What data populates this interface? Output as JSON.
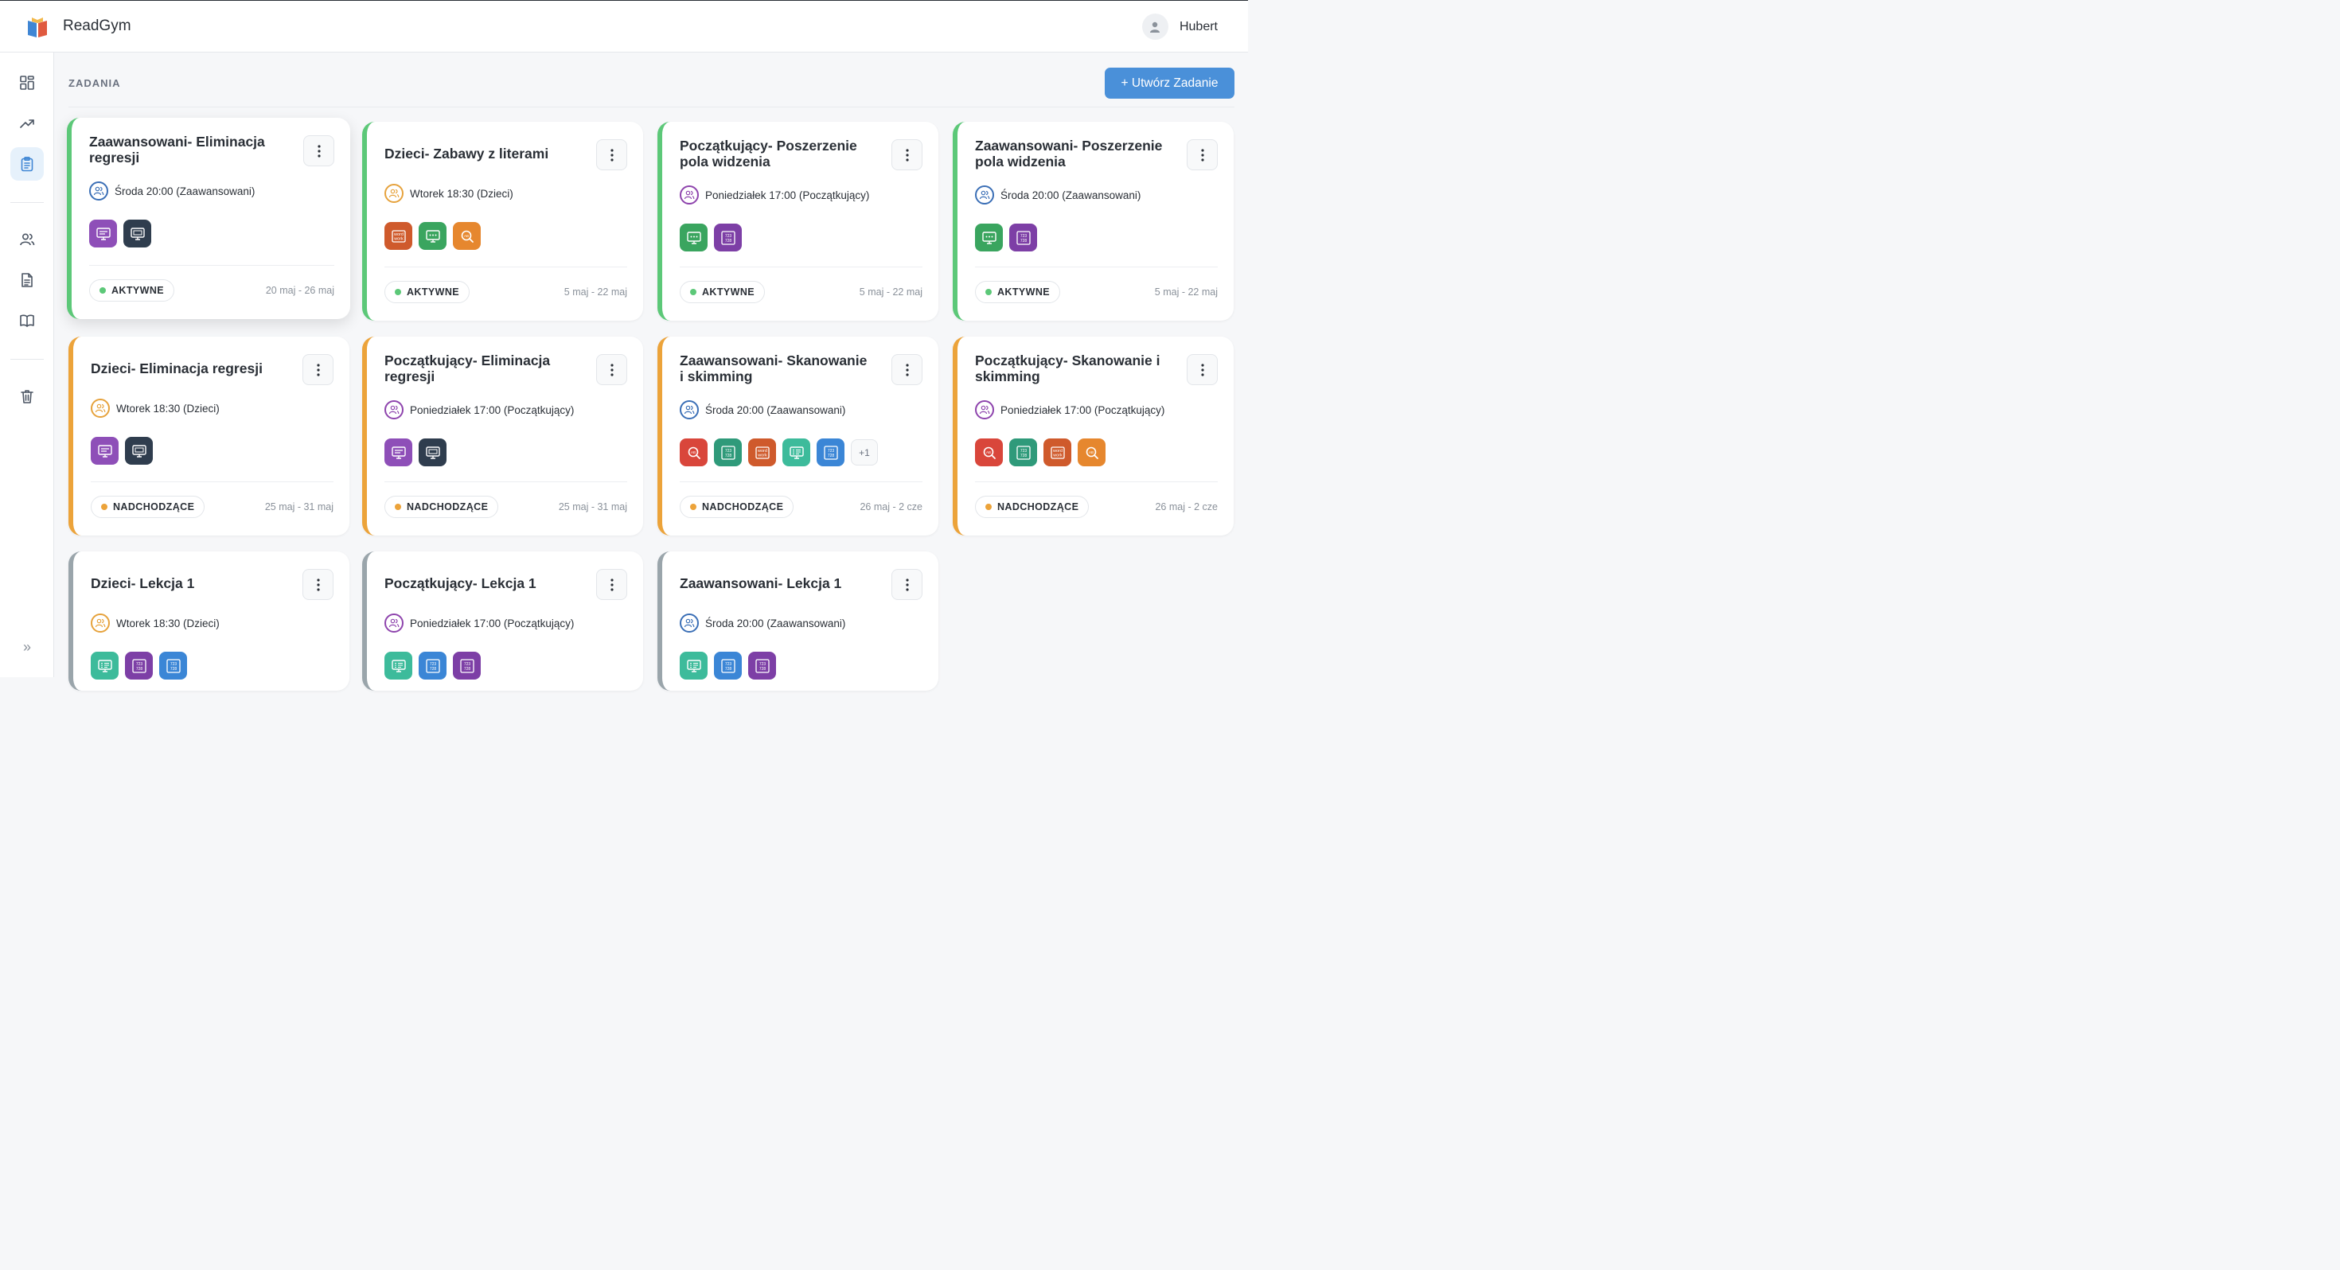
{
  "app": {
    "title": "ReadGym"
  },
  "user": {
    "name": "Hubert"
  },
  "page": {
    "section_title": "ZADANIA",
    "create_button": "+ Utwórz Zadanie"
  },
  "colors": {
    "accent": "#4a90d9",
    "active": "#5cc878",
    "upcoming": "#eca33a",
    "draft": "#9aa5ab"
  },
  "sidebar": {
    "items": [
      {
        "icon": "dashboard-icon"
      },
      {
        "icon": "trend-icon"
      },
      {
        "icon": "clipboard-icon",
        "active": true
      },
      {
        "icon": "users-icon"
      },
      {
        "icon": "document-icon"
      },
      {
        "icon": "book-icon"
      },
      {
        "icon": "trash-icon"
      },
      {
        "icon": "expand-icon",
        "label": "»"
      }
    ]
  },
  "cards": [
    {
      "title": "Zaawansowani- Eliminacja regresji",
      "group": "Środa 20:00 (Zaawansowani)",
      "group_color": "#3b6fb6",
      "exercises": [
        "monitor-purple",
        "monitor-dark"
      ],
      "more": "",
      "status": "AKTYWNE",
      "status_type": "active",
      "dates": "20 maj - 26 maj"
    },
    {
      "title": "Dzieci- Zabawy z literami",
      "group": "Wtorek 18:30 (Dzieci)",
      "group_color": "#e6a23c",
      "exercises": [
        "word-work",
        "dots-green",
        "search-orange"
      ],
      "more": "",
      "status": "AKTYWNE",
      "status_type": "active",
      "dates": "5 maj - 22 maj"
    },
    {
      "title": "Początkujący- Poszerzenie pola widzenia",
      "group": "Poniedziałek 17:00 (Początkujący)",
      "group_color": "#8e44ad",
      "exercises": [
        "dots-green",
        "numbers-purple"
      ],
      "more": "",
      "status": "AKTYWNE",
      "status_type": "active",
      "dates": "5 maj - 22 maj"
    },
    {
      "title": "Zaawansowani- Poszerzenie pola widzenia",
      "group": "Środa 20:00 (Zaawansowani)",
      "group_color": "#3b6fb6",
      "exercises": [
        "dots-green",
        "numbers-purple"
      ],
      "more": "",
      "status": "AKTYWNE",
      "status_type": "active",
      "dates": "5 maj - 22 maj"
    },
    {
      "title": "Dzieci- Eliminacja regresji",
      "group": "Wtorek 18:30 (Dzieci)",
      "group_color": "#e6a23c",
      "exercises": [
        "monitor-purple",
        "monitor-dark"
      ],
      "more": "",
      "status": "NADCHODZĄCE",
      "status_type": "upcoming",
      "dates": "25 maj - 31 maj"
    },
    {
      "title": "Początkujący- Eliminacja regresji",
      "group": "Poniedziałek 17:00 (Początkujący)",
      "group_color": "#8e44ad",
      "exercises": [
        "monitor-purple",
        "monitor-dark"
      ],
      "more": "",
      "status": "NADCHODZĄCE",
      "status_type": "upcoming",
      "dates": "25 maj - 31 maj"
    },
    {
      "title": "Zaawansowani- Skanowanie i skimming",
      "group": "Środa 20:00 (Zaawansowani)",
      "group_color": "#3b6fb6",
      "exercises": [
        "search-red",
        "numbers-teal",
        "word-work",
        "list-teal",
        "numbers-blue"
      ],
      "more": "+1",
      "status": "NADCHODZĄCE",
      "status_type": "upcoming",
      "dates": "26 maj - 2 cze"
    },
    {
      "title": "Początkujący- Skanowanie i skimming",
      "group": "Poniedziałek 17:00 (Początkujący)",
      "group_color": "#8e44ad",
      "exercises": [
        "search-red",
        "numbers-teal",
        "word-work",
        "search-orange"
      ],
      "more": "",
      "status": "NADCHODZĄCE",
      "status_type": "upcoming",
      "dates": "26 maj - 2 cze"
    },
    {
      "title": "Dzieci- Lekcja 1",
      "group": "Wtorek 18:30 (Dzieci)",
      "group_color": "#e6a23c",
      "exercises": [
        "list-teal",
        "numbers-purple",
        "numbers-blue"
      ],
      "more": "",
      "status": "",
      "status_type": "draft",
      "dates": ""
    },
    {
      "title": "Początkujący- Lekcja 1",
      "group": "Poniedziałek 17:00 (Początkujący)",
      "group_color": "#8e44ad",
      "exercises": [
        "list-teal",
        "numbers-blue",
        "numbers-purple"
      ],
      "more": "",
      "status": "",
      "status_type": "draft",
      "dates": ""
    },
    {
      "title": "Zaawansowani- Lekcja 1",
      "group": "Środa 20:00 (Zaawansowani)",
      "group_color": "#3b6fb6",
      "exercises": [
        "list-teal",
        "numbers-blue",
        "numbers-purple"
      ],
      "more": "",
      "status": "",
      "status_type": "draft",
      "dates": ""
    }
  ]
}
